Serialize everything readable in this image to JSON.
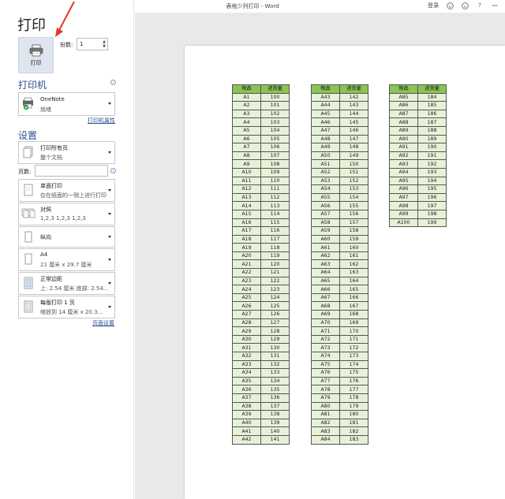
{
  "title_bar": {
    "doc_title": "表格少列打印 - Word",
    "login": "登录",
    "help": "?"
  },
  "backstage": {
    "heading": "打印",
    "print_button_label": "打印",
    "copies_label": "份数:",
    "copies_value": "1",
    "printer_heading": "打印机",
    "printer_name": "OneNote",
    "printer_status": "就绪",
    "printer_props_link": "打印机属性",
    "settings_heading": "设置",
    "settings": [
      {
        "line1": "打印所有页",
        "line2": "整个文档"
      },
      {
        "line1": "单面打印",
        "line2": "仅在纸面的一侧上进行打印"
      },
      {
        "line1": "对照",
        "line2": "1,2,3    1,2,3    1,2,3"
      },
      {
        "line1": "纵向",
        "line2": ""
      },
      {
        "line1": "A4",
        "line2": "21 厘米 x 29.7 厘米"
      },
      {
        "line1": "正常边距",
        "line2": "上: 2.54 厘米 底部: 2.54..."
      },
      {
        "line1": "每版打印 1 页",
        "line2": "缩放到 14 厘米 x 20.3..."
      }
    ],
    "pages_label": "页数:",
    "pages_value": "",
    "page_setup_link": "页面设置"
  },
  "preview": {
    "headers": [
      "物品",
      "进货量"
    ],
    "tables": [
      [
        [
          "A1",
          "100"
        ],
        [
          "A2",
          "101"
        ],
        [
          "A3",
          "102"
        ],
        [
          "A4",
          "103"
        ],
        [
          "A5",
          "104"
        ],
        [
          "A6",
          "105"
        ],
        [
          "A7",
          "106"
        ],
        [
          "A8",
          "107"
        ],
        [
          "A9",
          "108"
        ],
        [
          "A10",
          "109"
        ],
        [
          "A11",
          "110"
        ],
        [
          "A12",
          "111"
        ],
        [
          "A13",
          "112"
        ],
        [
          "A14",
          "113"
        ],
        [
          "A15",
          "114"
        ],
        [
          "A16",
          "115"
        ],
        [
          "A17",
          "116"
        ],
        [
          "A18",
          "117"
        ],
        [
          "A19",
          "118"
        ],
        [
          "A20",
          "119"
        ],
        [
          "A21",
          "120"
        ],
        [
          "A22",
          "121"
        ],
        [
          "A23",
          "122"
        ],
        [
          "A24",
          "123"
        ],
        [
          "A25",
          "124"
        ],
        [
          "A26",
          "125"
        ],
        [
          "A27",
          "126"
        ],
        [
          "A28",
          "127"
        ],
        [
          "A29",
          "128"
        ],
        [
          "A30",
          "129"
        ],
        [
          "A31",
          "130"
        ],
        [
          "A32",
          "131"
        ],
        [
          "A33",
          "132"
        ],
        [
          "A34",
          "133"
        ],
        [
          "A35",
          "134"
        ],
        [
          "A36",
          "135"
        ],
        [
          "A37",
          "136"
        ],
        [
          "A38",
          "137"
        ],
        [
          "A39",
          "138"
        ],
        [
          "A40",
          "139"
        ],
        [
          "A41",
          "140"
        ],
        [
          "A42",
          "141"
        ]
      ],
      [
        [
          "A43",
          "142"
        ],
        [
          "A44",
          "143"
        ],
        [
          "A45",
          "144"
        ],
        [
          "A46",
          "145"
        ],
        [
          "A47",
          "146"
        ],
        [
          "A48",
          "147"
        ],
        [
          "A49",
          "148"
        ],
        [
          "A50",
          "149"
        ],
        [
          "A51",
          "150"
        ],
        [
          "A52",
          "151"
        ],
        [
          "A53",
          "152"
        ],
        [
          "A54",
          "153"
        ],
        [
          "A55",
          "154"
        ],
        [
          "A56",
          "155"
        ],
        [
          "A57",
          "156"
        ],
        [
          "A58",
          "157"
        ],
        [
          "A59",
          "158"
        ],
        [
          "A60",
          "159"
        ],
        [
          "A61",
          "160"
        ],
        [
          "A62",
          "161"
        ],
        [
          "A63",
          "162"
        ],
        [
          "A64",
          "163"
        ],
        [
          "A65",
          "164"
        ],
        [
          "A66",
          "165"
        ],
        [
          "A67",
          "166"
        ],
        [
          "A68",
          "167"
        ],
        [
          "A69",
          "168"
        ],
        [
          "A70",
          "169"
        ],
        [
          "A71",
          "170"
        ],
        [
          "A72",
          "171"
        ],
        [
          "A73",
          "172"
        ],
        [
          "A74",
          "173"
        ],
        [
          "A75",
          "174"
        ],
        [
          "A76",
          "175"
        ],
        [
          "A77",
          "176"
        ],
        [
          "A78",
          "177"
        ],
        [
          "A79",
          "178"
        ],
        [
          "A80",
          "179"
        ],
        [
          "A81",
          "180"
        ],
        [
          "A82",
          "181"
        ],
        [
          "A83",
          "182"
        ],
        [
          "A84",
          "183"
        ]
      ],
      [
        [
          "A85",
          "184"
        ],
        [
          "A86",
          "185"
        ],
        [
          "A87",
          "186"
        ],
        [
          "A88",
          "187"
        ],
        [
          "A89",
          "188"
        ],
        [
          "A90",
          "189"
        ],
        [
          "A91",
          "190"
        ],
        [
          "A92",
          "191"
        ],
        [
          "A93",
          "192"
        ],
        [
          "A94",
          "193"
        ],
        [
          "A95",
          "194"
        ],
        [
          "A96",
          "195"
        ],
        [
          "A97",
          "196"
        ],
        [
          "A98",
          "197"
        ],
        [
          "A99",
          "198"
        ],
        [
          "A100",
          "199"
        ]
      ]
    ]
  },
  "colors": {
    "header_green": "#8ac554",
    "cell_green": "#e7f1d8",
    "accent_blue": "#2a4f8f",
    "arrow_red": "#e03a2c"
  }
}
